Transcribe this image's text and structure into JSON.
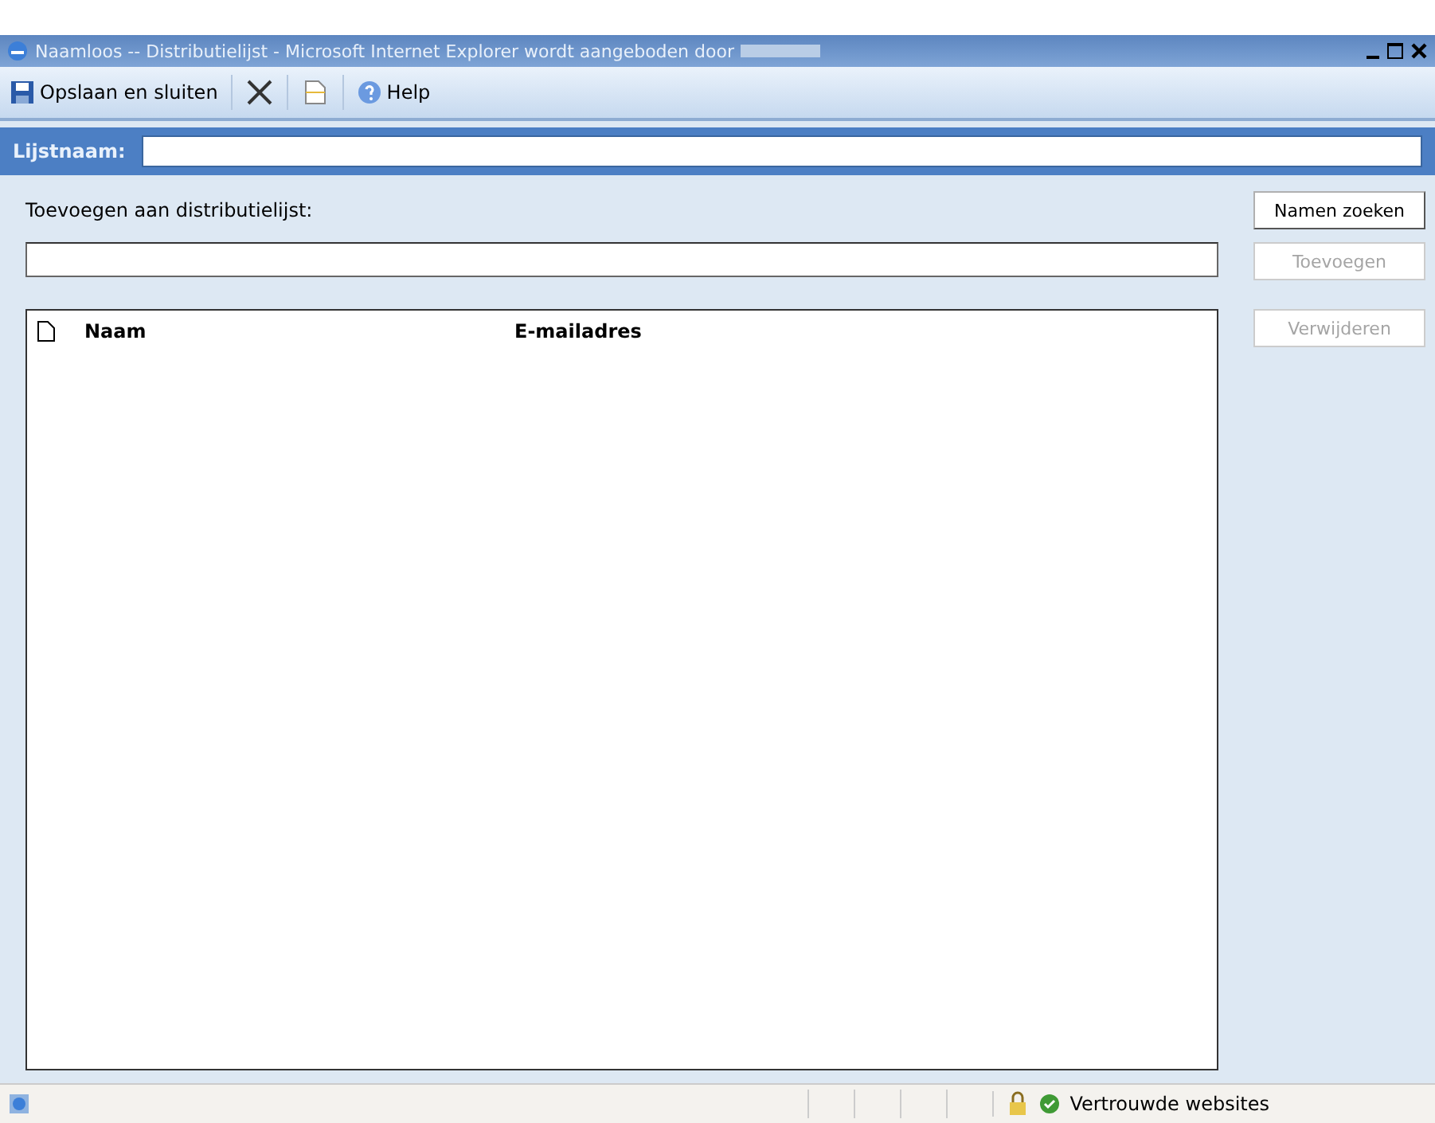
{
  "window": {
    "title": "Naamloos -- Distributielijst - Microsoft Internet Explorer wordt aangeboden door"
  },
  "toolbar": [
    {
      "kind": "save",
      "label": "Opslaan en sluiten"
    },
    {
      "kind": "delete"
    },
    {
      "kind": "page"
    },
    {
      "kind": "help",
      "label": "Help"
    }
  ],
  "list_name": {
    "label": "Lijstnaam:"
  },
  "add_section": {
    "label": "Toevoegen aan distributielijst:"
  },
  "buttons": [
    {
      "label": "Namen zoeken",
      "disabled": false
    },
    {
      "label": "Toevoegen",
      "disabled": true
    },
    {
      "label": "Verwijderen",
      "disabled": true
    }
  ],
  "table": {
    "columns": [
      "Naam",
      "E-mailadres"
    ]
  },
  "status_bar": {
    "zone": "Vertrouwde websites"
  }
}
